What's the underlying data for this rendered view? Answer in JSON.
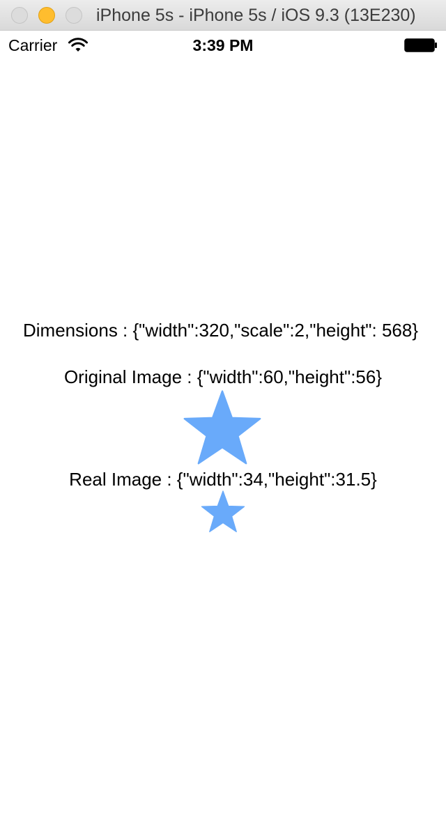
{
  "window": {
    "title": "iPhone 5s - iPhone 5s / iOS 9.3 (13E230)"
  },
  "status_bar": {
    "carrier": "Carrier",
    "time": "3:39 PM",
    "wifi_icon": "wifi-icon",
    "battery_icon": "battery-icon"
  },
  "content": {
    "dimensions_text": "Dimensions : {\"width\":320,\"scale\":2,\"height\": 568}",
    "original_image_text": "Original Image : {\"width\":60,\"height\":56}",
    "real_image_text": "Real Image : {\"width\":34,\"height\":31.5}",
    "star_icon": "star-icon"
  },
  "colors": {
    "star": "#69aafa",
    "traffic_minimize": "#ffbd2e"
  }
}
